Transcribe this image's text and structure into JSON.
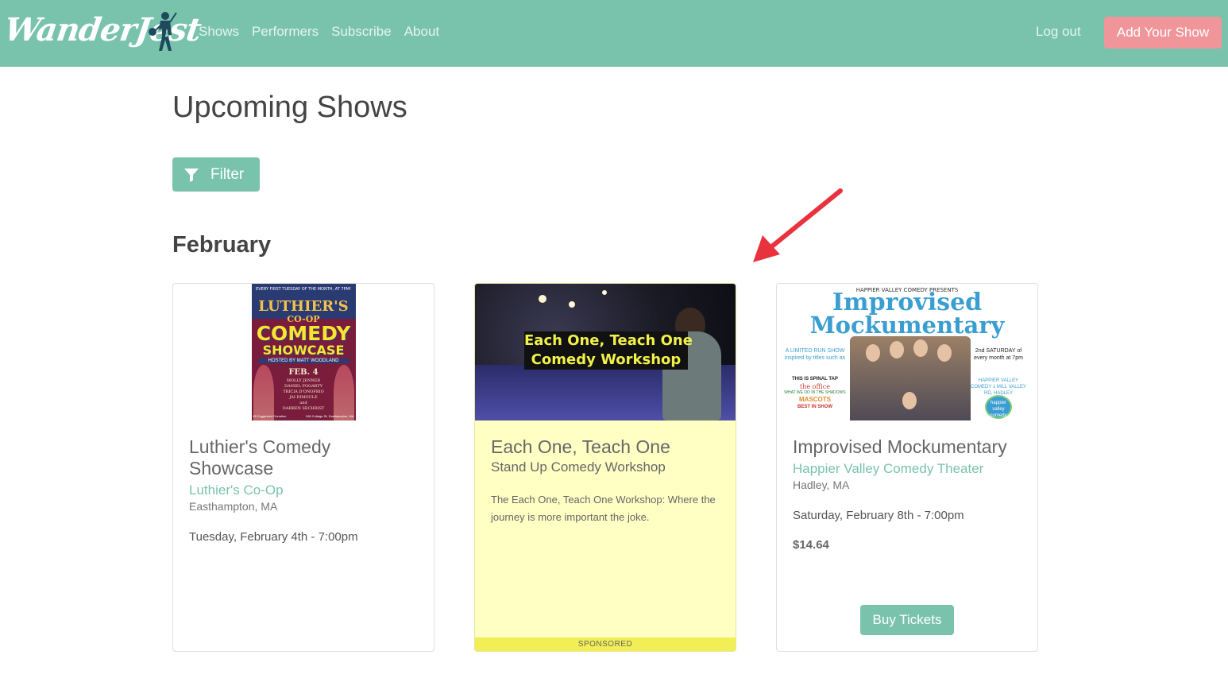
{
  "nav": {
    "logo_text": "WanderJest",
    "links": [
      {
        "label": "Shows"
      },
      {
        "label": "Performers"
      },
      {
        "label": "Subscribe"
      },
      {
        "label": "About"
      }
    ],
    "logout_label": "Log out",
    "add_show_label": "Add Your Show"
  },
  "page": {
    "title": "Upcoming Shows",
    "filter_label": "Filter",
    "month": "February"
  },
  "cards": [
    {
      "title": "Luthier's Comedy Showcase",
      "venue": "Luthier's Co-Op",
      "city": "Easthampton, MA",
      "date": "Tuesday, February 4th - 7:00pm",
      "poster": {
        "tag": "EVERY FIRST TUESDAY OF THE MONTH, AT 7PM!",
        "line1": "LUTHIER'S",
        "line2": "CO-OP",
        "line3": "COMEDY",
        "line4": "SHOWCASE",
        "host": "HOSTED BY MATT WOODLAND",
        "date": "FEB. 4",
        "names": [
          "MOLLY JENNER",
          "DANIEL FOGARTY",
          "TRICIA D'ONOFRIO",
          "JAI DIMOULE",
          "and",
          "DARREN SECHRIST"
        ],
        "foot_left": "$5 Suggested Donation",
        "foot_right": "108 Cottage St. Easthampton, MA"
      }
    },
    {
      "title": "Each One, Teach One",
      "subtitle": "Stand Up Comedy Workshop",
      "description": "The Each One, Teach One Workshop: Where the journey is more important the joke.",
      "sponsored_label": "SPONSORED",
      "poster": {
        "caption1": "Each One, Teach One",
        "caption2": "Comedy Workshop"
      }
    },
    {
      "title": "Improvised Mockumentary",
      "venue": "Happier Valley Comedy Theater",
      "city": "Hadley, MA",
      "date": "Saturday, February 8th - 7:00pm",
      "price": "$14.64",
      "buy_label": "Buy Tickets",
      "poster": {
        "presents": "HAPPIER VALLEY COMEDY PRESENTS",
        "title1": "Improvised",
        "title2": "Mockumentary",
        "left_top": "A LIMITED RUN SHOW inspired by titles such as",
        "left_b1": "THIS IS SPINAL TAP",
        "left_b2": "the office",
        "left_b3": "WHAT WE DO IN THE SHADOWS",
        "left_b4": "MASCOTS",
        "left_b5": "BEST IN SHOW",
        "right_top": "2nd SATURDAY of every month at 7pm",
        "right_bottom": "HAPPIER VALLEY COMEDY 1 MILL VALLEY RD, HADLEY",
        "badge": "happier valley comedy"
      }
    }
  ],
  "colors": {
    "brand": "#79c3ad",
    "cta": "#f0959a",
    "sponsored_bg": "#ffffc4",
    "sponsored_bar": "#f2ee55",
    "arrow": "#e8333f"
  },
  "icons": [
    "filter-icon",
    "wanderer-logo-icon",
    "annotation-arrow-icon"
  ]
}
